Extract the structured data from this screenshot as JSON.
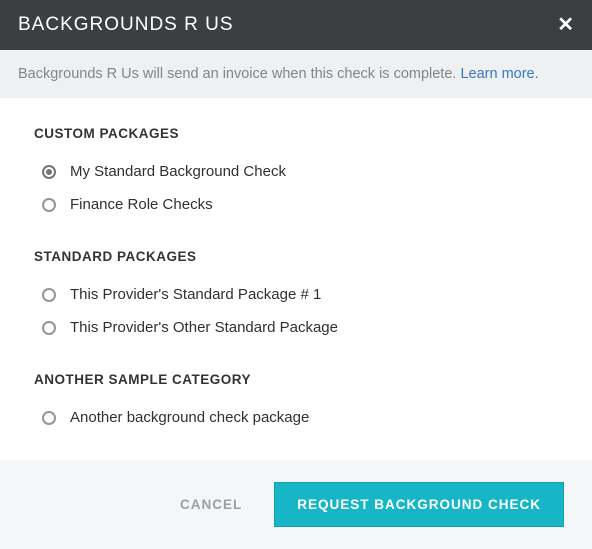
{
  "header": {
    "title": "BACKGROUNDS R US"
  },
  "info": {
    "text": "Backgrounds R Us will send an invoice when this check is complete. ",
    "link_text": "Learn more."
  },
  "categories": [
    {
      "title": "CUSTOM PACKAGES",
      "options": [
        {
          "label": "My Standard Background Check",
          "selected": true
        },
        {
          "label": "Finance Role Checks",
          "selected": false
        }
      ]
    },
    {
      "title": "STANDARD PACKAGES",
      "options": [
        {
          "label": "This Provider's Standard Package # 1",
          "selected": false
        },
        {
          "label": "This Provider's Other Standard Package",
          "selected": false
        }
      ]
    },
    {
      "title": "ANOTHER SAMPLE CATEGORY",
      "options": [
        {
          "label": "Another background check package",
          "selected": false
        }
      ]
    }
  ],
  "footer": {
    "cancel": "CANCEL",
    "submit": "REQUEST BACKGROUND CHECK"
  }
}
